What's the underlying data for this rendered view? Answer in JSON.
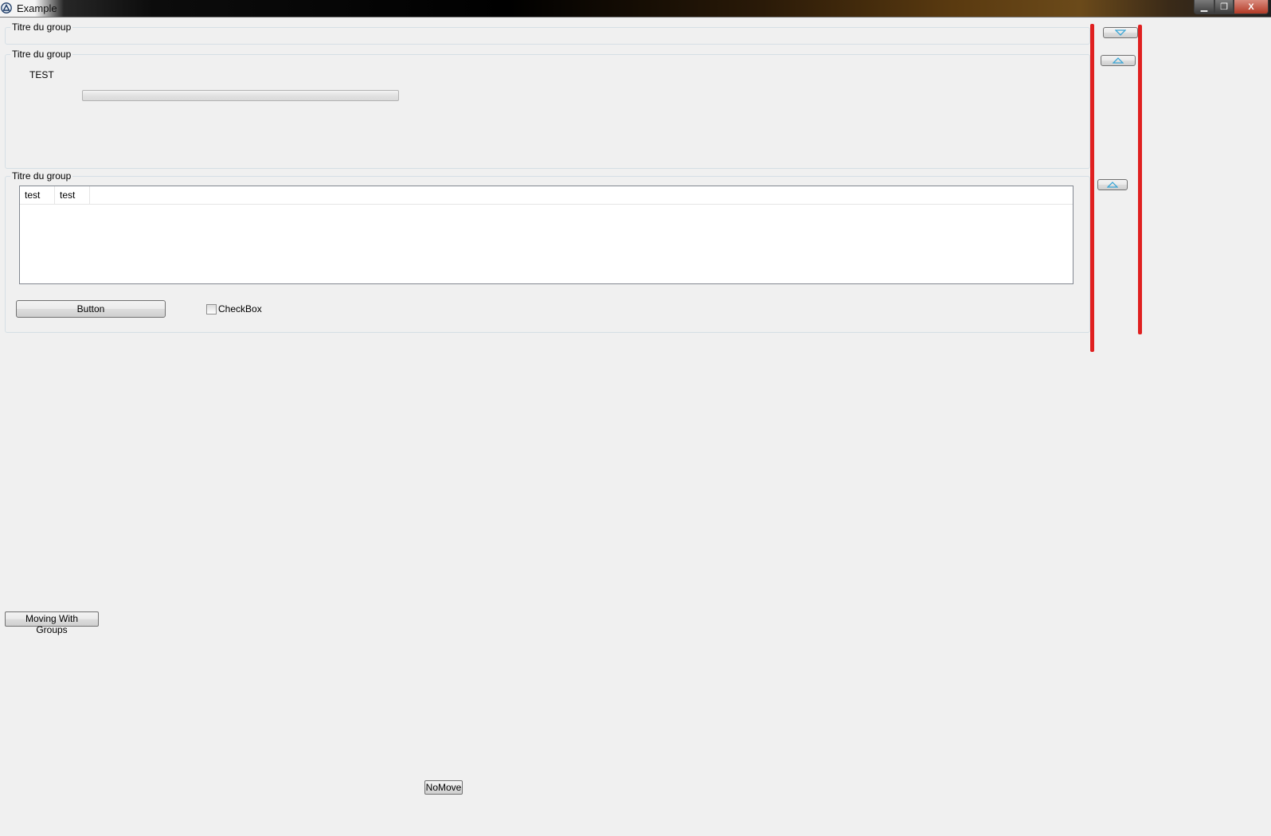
{
  "window": {
    "title": "Example",
    "controls": {
      "minimize": "▁",
      "maximize": "❐",
      "close": "X"
    }
  },
  "group1": {
    "title": "Titre du group"
  },
  "group2": {
    "title": "Titre du group",
    "label": "TEST",
    "progress": 0
  },
  "group3": {
    "title": "Titre du group",
    "listview": {
      "columns": [
        "test",
        "test"
      ],
      "rows": []
    },
    "button_label": "Button",
    "checkbox_label": "CheckBox",
    "checkbox_checked": false
  },
  "buttons": {
    "moving_with_groups": "Moving With Groups",
    "no_move": "NoMove"
  },
  "side_controls": {
    "group1_arrow": "chevron-down",
    "group2_arrow": "chevron-up",
    "group3_arrow": "chevron-up"
  },
  "colors": {
    "annotation_red": "#e02020",
    "arrow_cyan": "#3aa6d6"
  }
}
